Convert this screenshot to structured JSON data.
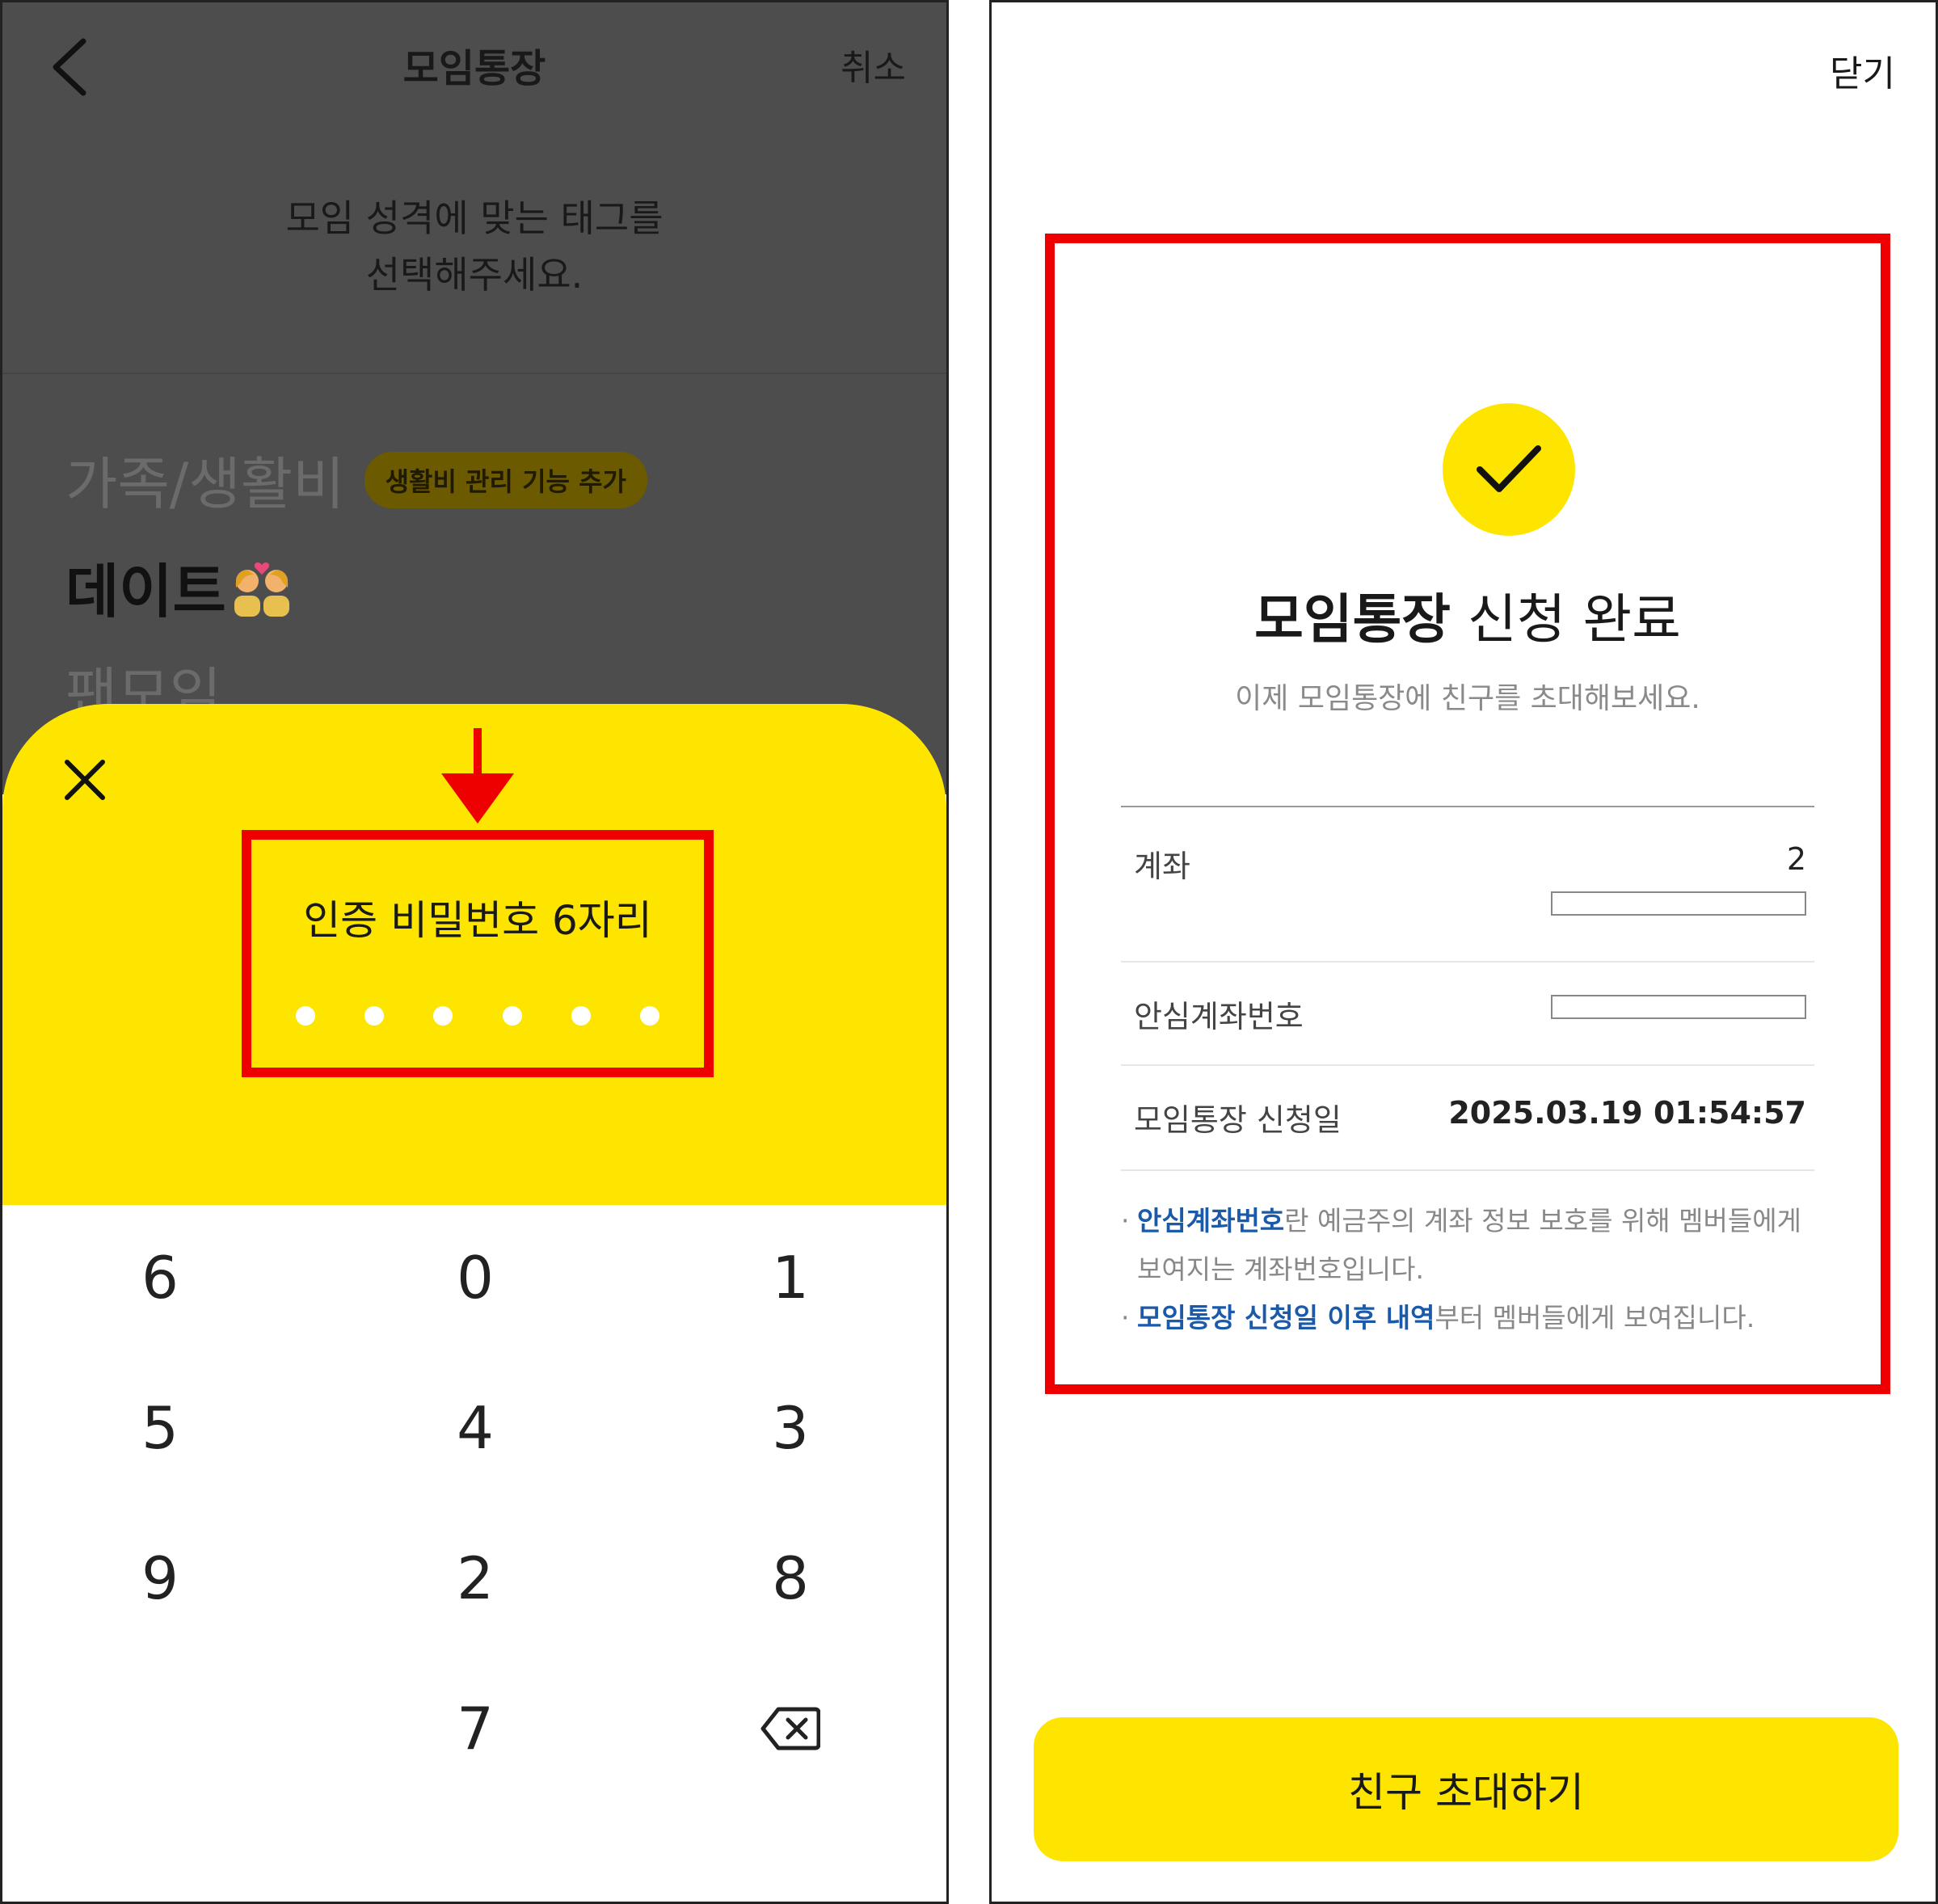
{
  "left": {
    "header": {
      "title": "모임통장",
      "cancel_label": "취소"
    },
    "prompt": "모임 성격에 맞는 태그를\n선택해주세요.",
    "tags": {
      "family": "가족/생활비",
      "family_badge": "생활비 관리 기능 추가",
      "date": "데이트",
      "fan": "팬모임"
    },
    "pin_sheet": {
      "title": "인증 비밀번호 6자리",
      "entered_count": 6
    },
    "keypad": {
      "keys": [
        "6",
        "0",
        "1",
        "5",
        "4",
        "3",
        "9",
        "2",
        "8",
        "7"
      ]
    }
  },
  "right": {
    "header": {
      "close_label": "닫기"
    },
    "complete": {
      "title_bold": "모임통장",
      "title_rest": " 신청 완료",
      "subtitle": "이제 모임통장에 친구를 초대해보세요."
    },
    "info": {
      "account_label": "계좌",
      "account_value": "2",
      "safe_account_label": "안심계좌번호",
      "apply_date_label": "모임통장 신청일",
      "apply_date_value": "2025.03.19 01:54:57"
    },
    "notes": {
      "note1_highlight": "안심계좌번호",
      "note1_rest_line1": "란 예금주의 계좌 정보 보호를 위해 멤버들에게",
      "note1_rest_line2": "보여지는 계좌번호입니다.",
      "note2_highlight": "모임통장 신청일 이후 내역",
      "note2_rest": "부터 멤버들에게 보여집니다."
    },
    "invite_button": "친구 초대하기"
  },
  "colors": {
    "kakao_yellow": "#fee500",
    "highlight_red": "#ee0000",
    "link_blue": "#1a5aa8"
  }
}
